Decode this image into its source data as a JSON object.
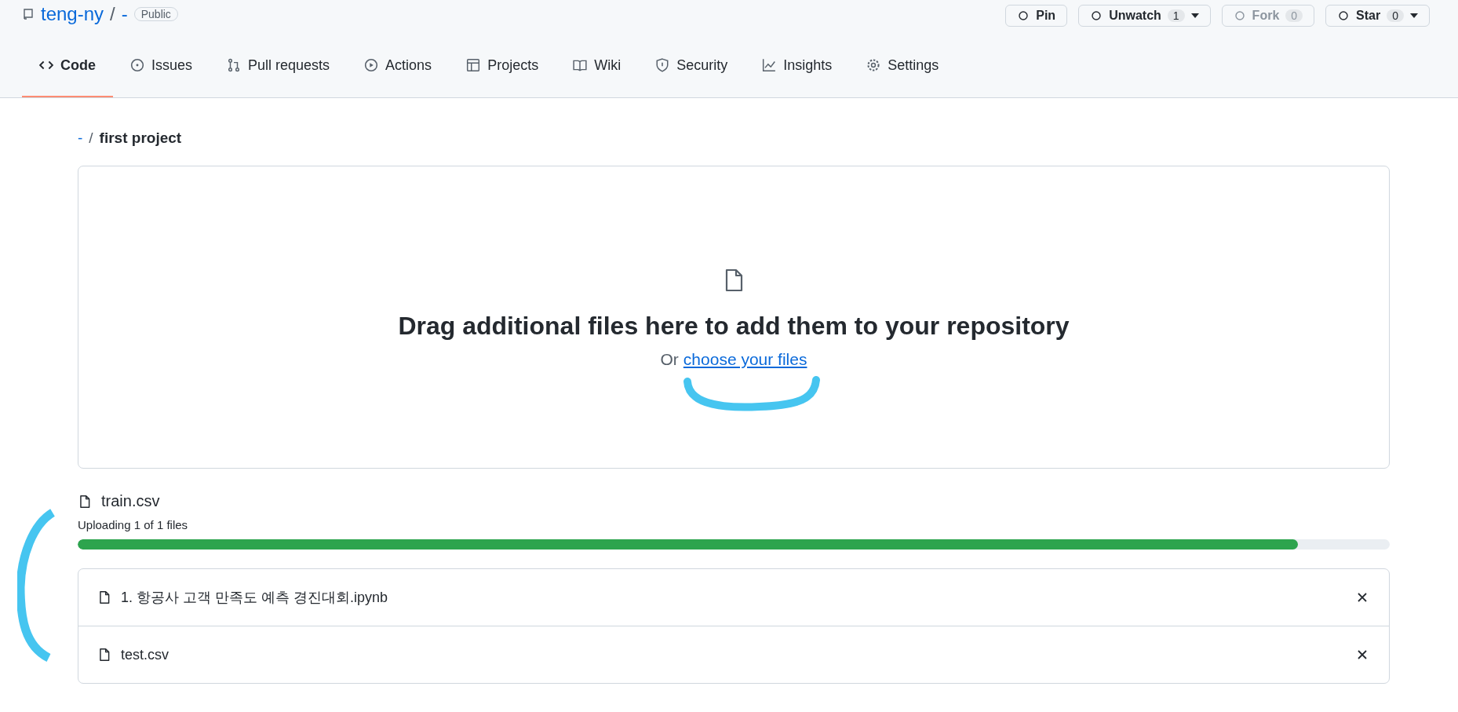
{
  "repo": {
    "owner": "teng-ny",
    "separator": "/",
    "name": "-",
    "visibility": "Public"
  },
  "repo_actions": [
    {
      "label": "Pin",
      "disabled": false
    },
    {
      "label": "Unwatch",
      "count": "1",
      "disabled": false,
      "dropdown": true
    },
    {
      "label": "Fork",
      "count": "0",
      "disabled": true
    },
    {
      "label": "Star",
      "count": "0",
      "disabled": false,
      "dropdown": true
    }
  ],
  "tabs": [
    {
      "label": "Code",
      "selected": true
    },
    {
      "label": "Issues",
      "selected": false
    },
    {
      "label": "Pull requests",
      "selected": false
    },
    {
      "label": "Actions",
      "selected": false
    },
    {
      "label": "Projects",
      "selected": false
    },
    {
      "label": "Wiki",
      "selected": false
    },
    {
      "label": "Security",
      "selected": false
    },
    {
      "label": "Insights",
      "selected": false
    },
    {
      "label": "Settings",
      "selected": false
    }
  ],
  "breadcrumb": {
    "root": "-",
    "separator": "/",
    "folder": "first project"
  },
  "dropzone": {
    "title": "Drag additional files here to add them to your repository",
    "prefix": "Or",
    "link": "choose your files"
  },
  "upload": {
    "file": "train.csv",
    "status": "Uploading 1 of 1 files",
    "level": 0.93
  },
  "files": [
    {
      "name": "1. 항공사 고객 만족도 예측 경진대회.ipynb"
    },
    {
      "name": "test.csv"
    }
  ]
}
